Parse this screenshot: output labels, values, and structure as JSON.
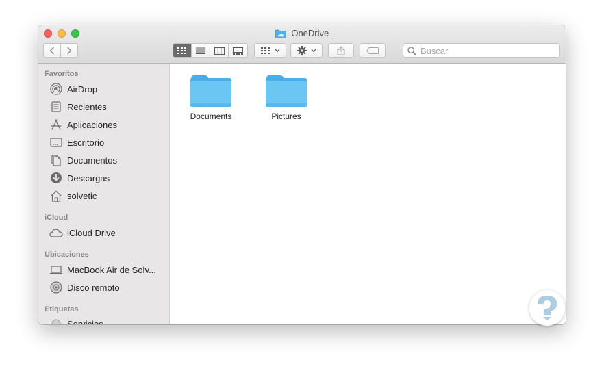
{
  "window": {
    "title": "OneDrive"
  },
  "toolbar": {
    "search_placeholder": "Buscar"
  },
  "sidebar": {
    "favorites_title": "Favoritos",
    "favorites": [
      {
        "label": "AirDrop",
        "icon": "airdrop-icon"
      },
      {
        "label": "Recientes",
        "icon": "recents-icon"
      },
      {
        "label": "Aplicaciones",
        "icon": "applications-icon"
      },
      {
        "label": "Escritorio",
        "icon": "desktop-icon"
      },
      {
        "label": "Documentos",
        "icon": "documents-icon"
      },
      {
        "label": "Descargas",
        "icon": "downloads-icon"
      },
      {
        "label": "solvetic",
        "icon": "home-icon"
      }
    ],
    "icloud_title": "iCloud",
    "icloud": [
      {
        "label": "iCloud Drive",
        "icon": "cloud-icon"
      }
    ],
    "locations_title": "Ubicaciones",
    "locations": [
      {
        "label": "MacBook Air de Solv...",
        "icon": "laptop-icon"
      },
      {
        "label": "Disco remoto",
        "icon": "disc-icon"
      }
    ],
    "tags_title": "Etiquetas",
    "tags": [
      {
        "label": "Servicios",
        "icon": "tag-icon"
      }
    ]
  },
  "files": [
    {
      "name": "Documents",
      "icon": "folder-icon"
    },
    {
      "name": "Pictures",
      "icon": "folder-icon"
    }
  ],
  "colors": {
    "folder": "#5cbcf0",
    "sidebar_bg": "#e8e6e6",
    "active_view": "#6b6b6b"
  }
}
